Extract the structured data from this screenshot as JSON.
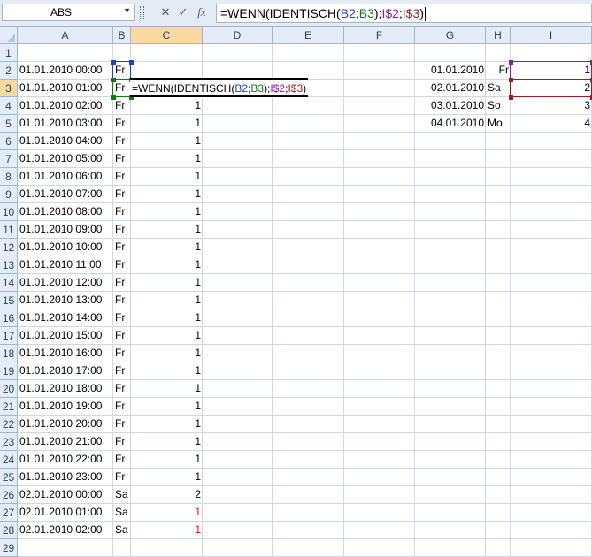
{
  "namebox": {
    "value": "ABS"
  },
  "formula_bar": {
    "cancel_symbol": "✕",
    "enter_symbol": "✓",
    "fx_label": "fx",
    "parts": [
      {
        "text": "=WENN(IDENTISCH(",
        "cls": ""
      },
      {
        "text": "B2",
        "cls": "refb"
      },
      {
        "text": ";",
        "cls": ""
      },
      {
        "text": "B3",
        "cls": "refg"
      },
      {
        "text": ");",
        "cls": ""
      },
      {
        "text": "I$2",
        "cls": "refp"
      },
      {
        "text": ";",
        "cls": ""
      },
      {
        "text": "I$3",
        "cls": "refr"
      },
      {
        "text": ")",
        "cls": ""
      }
    ]
  },
  "columns": [
    "A",
    "B",
    "C",
    "D",
    "E",
    "F",
    "G",
    "H",
    "I"
  ],
  "rows": [
    "1",
    "2",
    "3",
    "4",
    "5",
    "6",
    "7",
    "8",
    "9",
    "10",
    "11",
    "12",
    "13",
    "14",
    "15",
    "16",
    "17",
    "18",
    "19",
    "20",
    "21",
    "22",
    "23",
    "24",
    "25",
    "26",
    "27",
    "28",
    "29"
  ],
  "selected_column": "C",
  "selected_row": "3",
  "cells": [
    {
      "ref": "A2",
      "v": "01.01.2010 00:00"
    },
    {
      "ref": "B2",
      "v": "Fr"
    },
    {
      "ref": "A3",
      "v": "01.01.2010 01:00"
    },
    {
      "ref": "B3",
      "v": "Fr"
    },
    {
      "ref": "A4",
      "v": "01.01.2010 02:00"
    },
    {
      "ref": "B4",
      "v": "Fr"
    },
    {
      "ref": "C4",
      "v": "1",
      "num": true
    },
    {
      "ref": "A5",
      "v": "01.01.2010 03:00"
    },
    {
      "ref": "B5",
      "v": "Fr"
    },
    {
      "ref": "C5",
      "v": "1",
      "num": true
    },
    {
      "ref": "A6",
      "v": "01.01.2010 04:00"
    },
    {
      "ref": "B6",
      "v": "Fr"
    },
    {
      "ref": "C6",
      "v": "1",
      "num": true
    },
    {
      "ref": "A7",
      "v": "01.01.2010 05:00"
    },
    {
      "ref": "B7",
      "v": "Fr"
    },
    {
      "ref": "C7",
      "v": "1",
      "num": true
    },
    {
      "ref": "A8",
      "v": "01.01.2010 06:00"
    },
    {
      "ref": "B8",
      "v": "Fr"
    },
    {
      "ref": "C8",
      "v": "1",
      "num": true
    },
    {
      "ref": "A9",
      "v": "01.01.2010 07:00"
    },
    {
      "ref": "B9",
      "v": "Fr"
    },
    {
      "ref": "C9",
      "v": "1",
      "num": true
    },
    {
      "ref": "A10",
      "v": "01.01.2010 08:00"
    },
    {
      "ref": "B10",
      "v": "Fr"
    },
    {
      "ref": "C10",
      "v": "1",
      "num": true
    },
    {
      "ref": "A11",
      "v": "01.01.2010 09:00"
    },
    {
      "ref": "B11",
      "v": "Fr"
    },
    {
      "ref": "C11",
      "v": "1",
      "num": true
    },
    {
      "ref": "A12",
      "v": "01.01.2010 10:00"
    },
    {
      "ref": "B12",
      "v": "Fr"
    },
    {
      "ref": "C12",
      "v": "1",
      "num": true
    },
    {
      "ref": "A13",
      "v": "01.01.2010 11:00"
    },
    {
      "ref": "B13",
      "v": "Fr"
    },
    {
      "ref": "C13",
      "v": "1",
      "num": true
    },
    {
      "ref": "A14",
      "v": "01.01.2010 12:00"
    },
    {
      "ref": "B14",
      "v": "Fr"
    },
    {
      "ref": "C14",
      "v": "1",
      "num": true
    },
    {
      "ref": "A15",
      "v": "01.01.2010 13:00"
    },
    {
      "ref": "B15",
      "v": "Fr"
    },
    {
      "ref": "C15",
      "v": "1",
      "num": true
    },
    {
      "ref": "A16",
      "v": "01.01.2010 14:00"
    },
    {
      "ref": "B16",
      "v": "Fr"
    },
    {
      "ref": "C16",
      "v": "1",
      "num": true
    },
    {
      "ref": "A17",
      "v": "01.01.2010 15:00"
    },
    {
      "ref": "B17",
      "v": "Fr"
    },
    {
      "ref": "C17",
      "v": "1",
      "num": true
    },
    {
      "ref": "A18",
      "v": "01.01.2010 16:00"
    },
    {
      "ref": "B18",
      "v": "Fr"
    },
    {
      "ref": "C18",
      "v": "1",
      "num": true
    },
    {
      "ref": "A19",
      "v": "01.01.2010 17:00"
    },
    {
      "ref": "B19",
      "v": "Fr"
    },
    {
      "ref": "C19",
      "v": "1",
      "num": true
    },
    {
      "ref": "A20",
      "v": "01.01.2010 18:00"
    },
    {
      "ref": "B20",
      "v": "Fr"
    },
    {
      "ref": "C20",
      "v": "1",
      "num": true
    },
    {
      "ref": "A21",
      "v": "01.01.2010 19:00"
    },
    {
      "ref": "B21",
      "v": "Fr"
    },
    {
      "ref": "C21",
      "v": "1",
      "num": true
    },
    {
      "ref": "A22",
      "v": "01.01.2010 20:00"
    },
    {
      "ref": "B22",
      "v": "Fr"
    },
    {
      "ref": "C22",
      "v": "1",
      "num": true
    },
    {
      "ref": "A23",
      "v": "01.01.2010 21:00"
    },
    {
      "ref": "B23",
      "v": "Fr"
    },
    {
      "ref": "C23",
      "v": "1",
      "num": true
    },
    {
      "ref": "A24",
      "v": "01.01.2010 22:00"
    },
    {
      "ref": "B24",
      "v": "Fr"
    },
    {
      "ref": "C24",
      "v": "1",
      "num": true
    },
    {
      "ref": "A25",
      "v": "01.01.2010 23:00"
    },
    {
      "ref": "B25",
      "v": "Fr"
    },
    {
      "ref": "C25",
      "v": "1",
      "num": true
    },
    {
      "ref": "A26",
      "v": "02.01.2010 00:00"
    },
    {
      "ref": "B26",
      "v": "Sa"
    },
    {
      "ref": "C26",
      "v": "2",
      "num": true
    },
    {
      "ref": "A27",
      "v": "02.01.2010 01:00"
    },
    {
      "ref": "B27",
      "v": "Sa"
    },
    {
      "ref": "C27",
      "v": "1",
      "num": true,
      "red": true
    },
    {
      "ref": "A28",
      "v": "02.01.2010 02:00"
    },
    {
      "ref": "B28",
      "v": "Sa"
    },
    {
      "ref": "C28",
      "v": "1",
      "num": true,
      "red": true
    },
    {
      "ref": "G2",
      "v": "01.01.2010",
      "num": true
    },
    {
      "ref": "H2",
      "v": "Fr",
      "num": true
    },
    {
      "ref": "I2",
      "v": "1",
      "num": true
    },
    {
      "ref": "G3",
      "v": "02.01.2010",
      "num": true
    },
    {
      "ref": "H3",
      "v": "Sa"
    },
    {
      "ref": "I3",
      "v": "2",
      "num": true
    },
    {
      "ref": "G4",
      "v": "03.01.2010",
      "num": true
    },
    {
      "ref": "H4",
      "v": "So"
    },
    {
      "ref": "I4",
      "v": "3",
      "num": true
    },
    {
      "ref": "G5",
      "v": "04.01.2010",
      "num": true
    },
    {
      "ref": "H5",
      "v": "Mo"
    },
    {
      "ref": "I5",
      "v": "4",
      "num": true
    }
  ],
  "editing_cell": {
    "ref": "C3"
  },
  "ref_colors": {
    "B2": "#1f3fd0",
    "B3": "#107c10",
    "I2": "#8e1aa4",
    "I3": "#9c1c1c"
  }
}
